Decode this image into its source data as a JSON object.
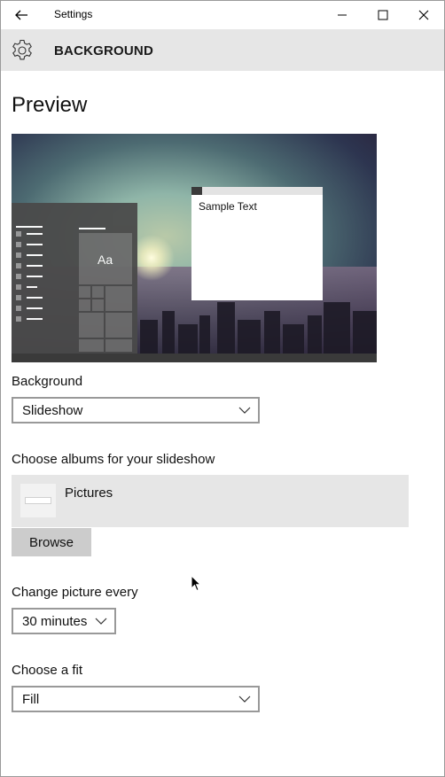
{
  "window": {
    "title": "Settings",
    "controls": {
      "minimize": "minimize-icon",
      "maximize": "maximize-icon",
      "close": "close-icon"
    }
  },
  "header": {
    "title": "BACKGROUND",
    "icon": "gear-icon"
  },
  "preview": {
    "title": "Preview",
    "sample_text": "Sample Text",
    "tile_text": "Aa"
  },
  "background": {
    "label": "Background",
    "selected": "Slideshow"
  },
  "albums": {
    "label": "Choose albums for your slideshow",
    "items": [
      {
        "name": "Pictures"
      }
    ],
    "browse_label": "Browse"
  },
  "interval": {
    "label": "Change picture every",
    "selected": "30 minutes"
  },
  "fit": {
    "label": "Choose a fit",
    "selected": "Fill"
  },
  "colors": {
    "header_bg": "#e6e6e6",
    "button_bg": "#cccccc",
    "accent": "#0078d7"
  }
}
